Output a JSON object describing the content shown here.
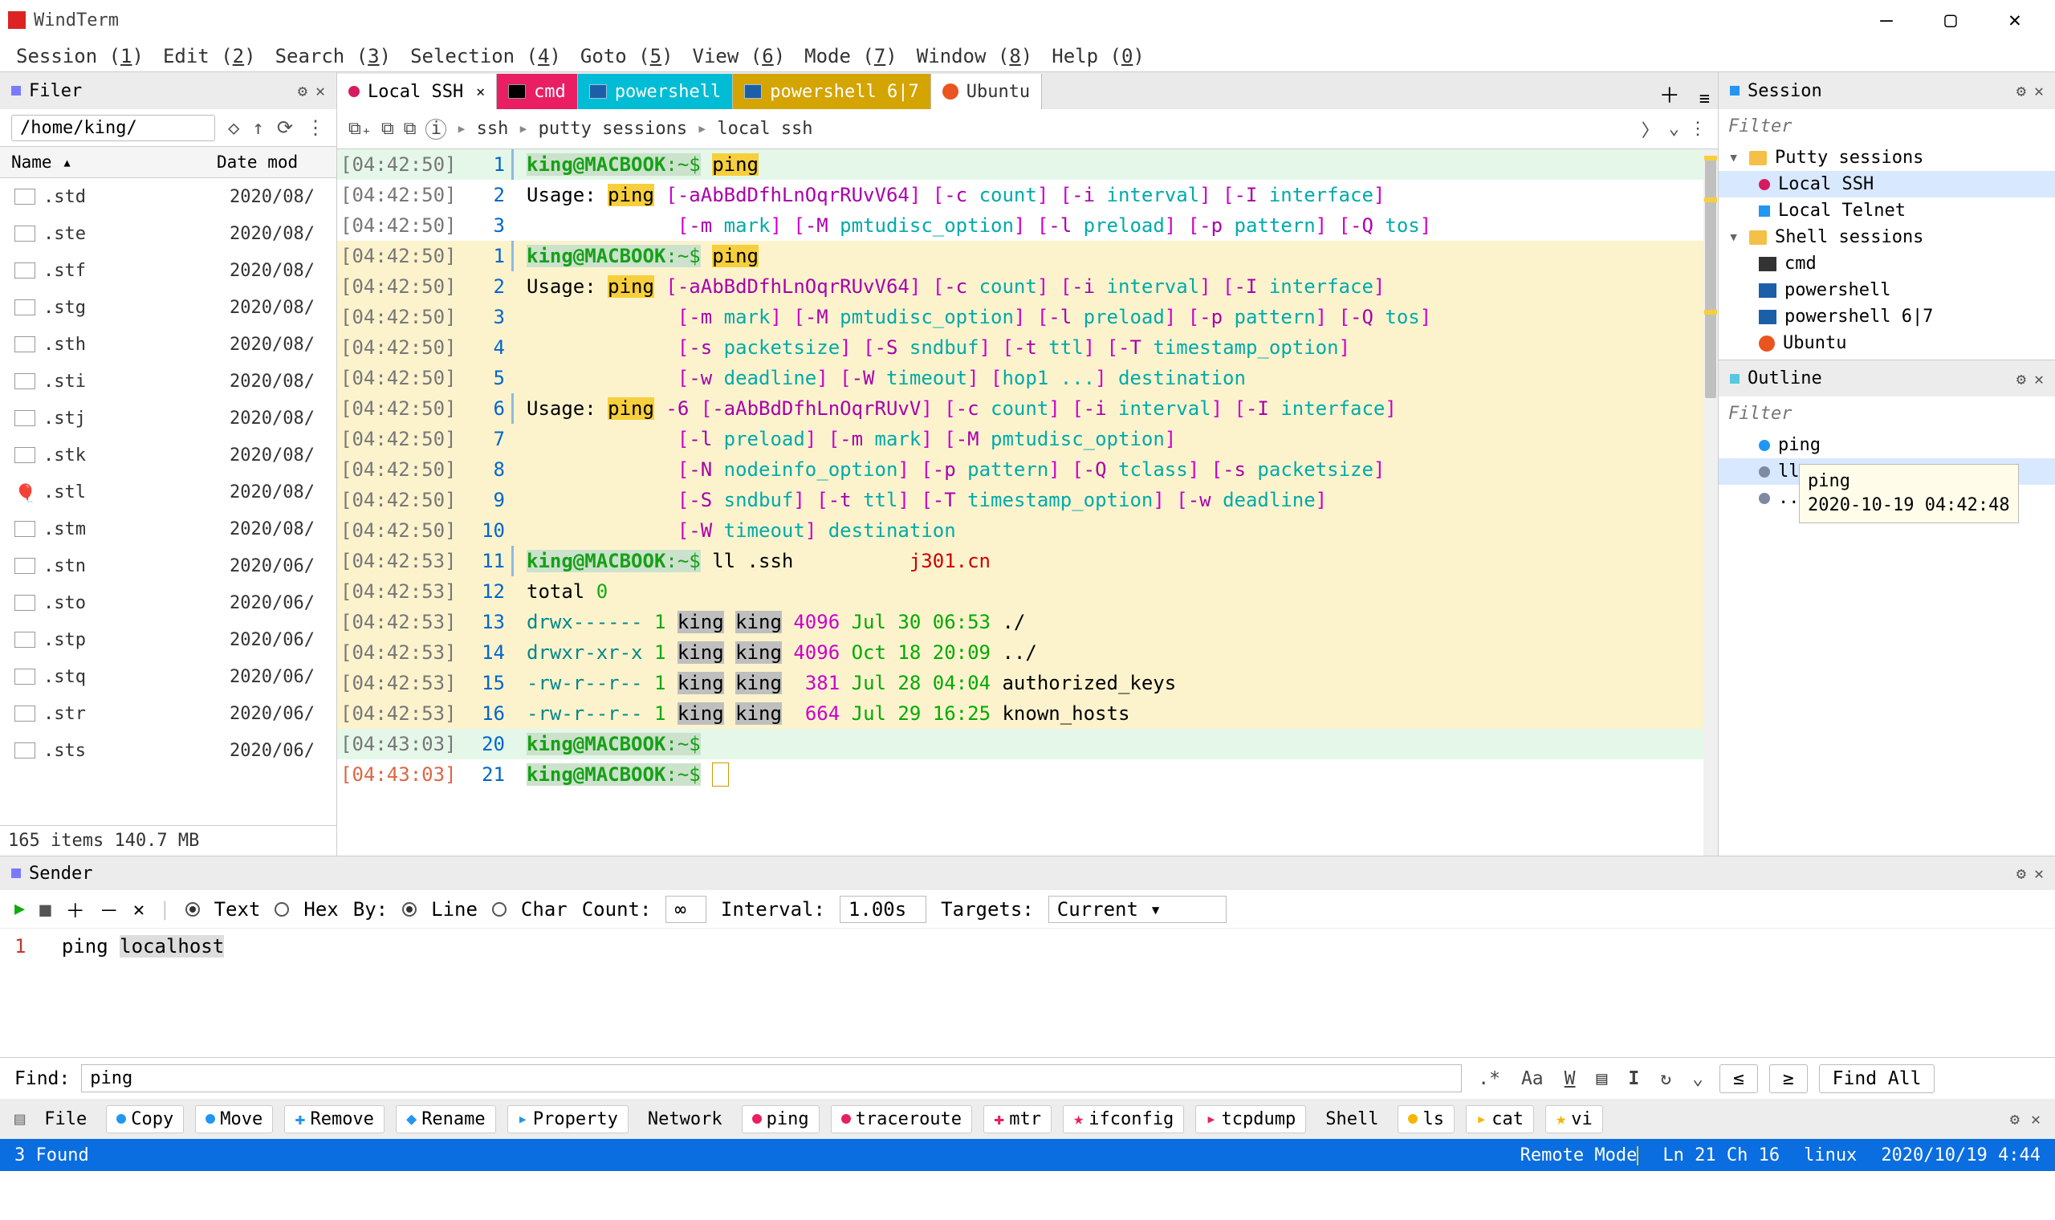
{
  "app": {
    "title": "WindTerm"
  },
  "menu": [
    "Session (1)",
    "Edit (2)",
    "Search (3)",
    "Selection (4)",
    "Goto (5)",
    "View (6)",
    "Mode (7)",
    "Window (8)",
    "Help (0)"
  ],
  "filer": {
    "panel_title": "Filer",
    "path": "/home/king/",
    "columns": [
      "Name",
      "Date mod"
    ],
    "rows": [
      {
        "name": ".std",
        "date": "2020/08/",
        "icon": "file"
      },
      {
        "name": ".ste",
        "date": "2020/08/",
        "icon": "file"
      },
      {
        "name": ".stf",
        "date": "2020/08/",
        "icon": "file"
      },
      {
        "name": ".stg",
        "date": "2020/08/",
        "icon": "file"
      },
      {
        "name": ".sth",
        "date": "2020/08/",
        "icon": "file"
      },
      {
        "name": ".sti",
        "date": "2020/08/",
        "icon": "file"
      },
      {
        "name": ".stj",
        "date": "2020/08/",
        "icon": "file"
      },
      {
        "name": ".stk",
        "date": "2020/08/",
        "icon": "file"
      },
      {
        "name": ".stl",
        "date": "2020/08/",
        "icon": "balloon"
      },
      {
        "name": ".stm",
        "date": "2020/08/",
        "icon": "file"
      },
      {
        "name": ".stn",
        "date": "2020/06/",
        "icon": "file"
      },
      {
        "name": ".sto",
        "date": "2020/06/",
        "icon": "file"
      },
      {
        "name": ".stp",
        "date": "2020/06/",
        "icon": "file"
      },
      {
        "name": ".stq",
        "date": "2020/06/",
        "icon": "file"
      },
      {
        "name": ".str",
        "date": "2020/06/",
        "icon": "file"
      },
      {
        "name": ".sts",
        "date": "2020/06/",
        "icon": "file"
      }
    ],
    "status": "165 items 140.7 MB"
  },
  "tabs": [
    {
      "label": "Local SSH",
      "bg": "#ffffff",
      "dot": "#d81b60"
    },
    {
      "label": "cmd",
      "bg": "#e91e63",
      "fg": "#fff",
      "icon": "#000"
    },
    {
      "label": "powershell",
      "bg": "#00bcd4",
      "fg": "#fff",
      "icon": "#1b5fa8"
    },
    {
      "label": "powershell 6|7",
      "bg": "#d4a400",
      "fg": "#fff",
      "icon": "#1b5fa8"
    },
    {
      "label": "Ubuntu",
      "bg": "#ffffff",
      "icon": "#e95420",
      "fg": "#333"
    }
  ],
  "breadcrumb": [
    "ssh",
    "putty sessions",
    "local ssh"
  ],
  "terminal": {
    "watermark": "j301.cn",
    "lines": [
      {
        "ts": "[04:42:50]",
        "n": "1",
        "bg": "top",
        "fold": 1,
        "html": "<span class='prompt'><span class='u'>king</span><span class='h'>@MACBOOK</span><span class='p'>:~$</span></span> <span class='hi'>ping</span>"
      },
      {
        "ts": "[04:42:50]",
        "n": "2",
        "bg": "use",
        "html": "Usage: <span class='hi'>ping</span> <span class='mag'>[</span><span class='dmag'>-aAbBdDfhLnOqrRUvV64</span><span class='mag'>]</span> <span class='mag'>[</span><span class='dmag'>-c</span> <span class='cyan'>count</span><span class='mag'>]</span> <span class='mag'>[</span><span class='dmag'>-i</span> <span class='cyan'>interval</span><span class='mag'>]</span> <span class='mag'>[</span><span class='dmag'>-I</span> <span class='cyan'>interface</span><span class='mag'>]</span>"
      },
      {
        "ts": "[04:42:50]",
        "n": "3",
        "bg": "use",
        "html": "             <span class='mag'>[</span><span class='dmag'>-m</span> <span class='cyan'>mark</span><span class='mag'>]</span> <span class='mag'>[</span><span class='dmag'>-M</span> <span class='cyan'>pmtudisc_option</span><span class='mag'>]</span> <span class='mag'>[</span><span class='dmag'>-l</span> <span class='cyan'>preload</span><span class='mag'>]</span> <span class='mag'>[</span><span class='dmag'>-p</span> <span class='cyan'>pattern</span><span class='mag'>]</span> <span class='mag'>[</span><span class='dmag'>-Q</span> <span class='cyan'>tos</span><span class='mag'>]</span>"
      },
      {
        "ts": "[04:42:50]",
        "n": "1",
        "bg": "yel",
        "fold": 1,
        "html": "<span class='prompt'><span class='u'>king</span><span class='h'>@MACBOOK</span><span class='p'>:~$</span></span> <span class='hi'>ping</span>"
      },
      {
        "ts": "[04:42:50]",
        "n": "2",
        "bg": "yel",
        "html": "Usage: <span class='hi'>ping</span> <span class='mag'>[</span><span class='dmag'>-aAbBdDfhLnOqrRUvV64</span><span class='mag'>]</span> <span class='mag'>[</span><span class='dmag'>-c</span> <span class='cyan'>count</span><span class='mag'>]</span> <span class='mag'>[</span><span class='dmag'>-i</span> <span class='cyan'>interval</span><span class='mag'>]</span> <span class='mag'>[</span><span class='dmag'>-I</span> <span class='cyan'>interface</span><span class='mag'>]</span>"
      },
      {
        "ts": "[04:42:50]",
        "n": "3",
        "bg": "yel",
        "html": "             <span class='mag'>[</span><span class='dmag'>-m</span> <span class='cyan'>mark</span><span class='mag'>]</span> <span class='mag'>[</span><span class='dmag'>-M</span> <span class='cyan'>pmtudisc_option</span><span class='mag'>]</span> <span class='mag'>[</span><span class='dmag'>-l</span> <span class='cyan'>preload</span><span class='mag'>]</span> <span class='mag'>[</span><span class='dmag'>-p</span> <span class='cyan'>pattern</span><span class='mag'>]</span> <span class='mag'>[</span><span class='dmag'>-Q</span> <span class='cyan'>tos</span><span class='mag'>]</span>"
      },
      {
        "ts": "[04:42:50]",
        "n": "4",
        "bg": "yel",
        "html": "             <span class='mag'>[</span><span class='dmag'>-s</span> <span class='cyan'>packetsize</span><span class='mag'>]</span> <span class='mag'>[</span><span class='dmag'>-S</span> <span class='cyan'>sndbuf</span><span class='mag'>]</span> <span class='mag'>[</span><span class='dmag'>-t</span> <span class='cyan'>ttl</span><span class='mag'>]</span> <span class='mag'>[</span><span class='dmag'>-T</span> <span class='cyan'>timestamp_option</span><span class='mag'>]</span>"
      },
      {
        "ts": "[04:42:50]",
        "n": "5",
        "bg": "yel",
        "html": "             <span class='mag'>[</span><span class='dmag'>-w</span> <span class='cyan'>deadline</span><span class='mag'>]</span> <span class='mag'>[</span><span class='dmag'>-W</span> <span class='cyan'>timeout</span><span class='mag'>]</span> <span class='mag'>[</span><span class='cyan'>hop1 ...</span><span class='mag'>]</span> <span class='cyan'>destination</span>"
      },
      {
        "ts": "[04:42:50]",
        "n": "6",
        "bg": "yel",
        "fold": 1,
        "html": "Usage: <span class='hi'>ping</span> <span class='dmag'>-6</span> <span class='mag'>[</span><span class='dmag'>-aAbBdDfhLnOqrRUvV</span><span class='mag'>]</span> <span class='mag'>[</span><span class='dmag'>-c</span> <span class='cyan'>count</span><span class='mag'>]</span> <span class='mag'>[</span><span class='dmag'>-i</span> <span class='cyan'>interval</span><span class='mag'>]</span> <span class='mag'>[</span><span class='dmag'>-I</span> <span class='cyan'>interface</span><span class='mag'>]</span>"
      },
      {
        "ts": "[04:42:50]",
        "n": "7",
        "bg": "yel",
        "html": "             <span class='mag'>[</span><span class='dmag'>-l</span> <span class='cyan'>preload</span><span class='mag'>]</span> <span class='mag'>[</span><span class='dmag'>-m</span> <span class='cyan'>mark</span><span class='mag'>]</span> <span class='mag'>[</span><span class='dmag'>-M</span> <span class='cyan'>pmtudisc_option</span><span class='mag'>]</span>"
      },
      {
        "ts": "[04:42:50]",
        "n": "8",
        "bg": "yel",
        "html": "             <span class='mag'>[</span><span class='dmag'>-N</span> <span class='cyan'>nodeinfo_option</span><span class='mag'>]</span> <span class='mag'>[</span><span class='dmag'>-p</span> <span class='cyan'>pattern</span><span class='mag'>]</span> <span class='mag'>[</span><span class='dmag'>-Q</span> <span class='cyan'>tclass</span><span class='mag'>]</span> <span class='mag'>[</span><span class='dmag'>-s</span> <span class='cyan'>packetsize</span><span class='mag'>]</span>"
      },
      {
        "ts": "[04:42:50]",
        "n": "9",
        "bg": "yel",
        "html": "             <span class='mag'>[</span><span class='dmag'>-S</span> <span class='cyan'>sndbuf</span><span class='mag'>]</span> <span class='mag'>[</span><span class='dmag'>-t</span> <span class='cyan'>ttl</span><span class='mag'>]</span> <span class='mag'>[</span><span class='dmag'>-T</span> <span class='cyan'>timestamp_option</span><span class='mag'>]</span> <span class='mag'>[</span><span class='dmag'>-w</span> <span class='cyan'>deadline</span><span class='mag'>]</span>"
      },
      {
        "ts": "[04:42:50]",
        "n": "10",
        "bg": "yel",
        "html": "             <span class='mag'>[</span><span class='dmag'>-W</span> <span class='cyan'>timeout</span><span class='mag'>]</span> <span class='cyan'>destination</span>"
      },
      {
        "ts": "[04:42:53]",
        "n": "11",
        "bg": "yel",
        "fold": 1,
        "html": "<span class='prompt'><span class='u'>king</span><span class='h'>@MACBOOK</span><span class='p'>:~$</span></span> ll .ssh          <span class='red'>j301.cn</span>"
      },
      {
        "ts": "[04:42:53]",
        "n": "12",
        "bg": "yel",
        "html": "total <span class='green'>0</span>"
      },
      {
        "ts": "[04:42:53]",
        "n": "13",
        "bg": "yel",
        "html": "<span class='dcyan'>drwx------</span> <span class='green'>1</span> <span class='tsel'>king</span> <span class='tsel'>king</span> <span class='mag'>4096</span> <span class='dgreen'>Jul 30 06:53</span> ./"
      },
      {
        "ts": "[04:42:53]",
        "n": "14",
        "bg": "yel",
        "html": "<span class='dcyan'>drwxr-xr-x</span> <span class='green'>1</span> <span class='tsel'>king</span> <span class='tsel'>king</span> <span class='mag'>4096</span> <span class='dgreen'>Oct 18 20:09</span> ../"
      },
      {
        "ts": "[04:42:53]",
        "n": "15",
        "bg": "yel",
        "html": "<span class='dcyan'>-rw-r--r--</span> <span class='green'>1</span> <span class='tsel'>king</span> <span class='tsel'>king</span>  <span class='mag'>381</span> <span class='dgreen'>Jul 28 04:04</span> authorized_keys"
      },
      {
        "ts": "[04:42:53]",
        "n": "16",
        "bg": "yel",
        "html": "<span class='dcyan'>-rw-r--r--</span> <span class='green'>1</span> <span class='tsel'>king</span> <span class='tsel'>king</span>  <span class='mag'>664</span> <span class='dgreen'>Jul 29 16:25</span> known_hosts"
      },
      {
        "ts": "[04:43:03]",
        "n": "20",
        "bg": "cur",
        "html": "<span class='prompt'><span class='u'>king</span><span class='h'>@MACBOOK</span><span class='p'>:~$</span></span>"
      },
      {
        "ts": "[04:43:03]",
        "tsc": "now",
        "n": "21",
        "bg": "use",
        "html": "<span class='prompt'><span class='u'>king</span><span class='h'>@MACBOOK</span><span class='p'>:~$</span></span> <span style='border:1px solid #c90;padding:0 2px;'>&nbsp;</span>"
      }
    ]
  },
  "session": {
    "panel_title": "Session",
    "filter_placeholder": "Filter",
    "tree": [
      {
        "lvl": 1,
        "type": "folder",
        "twist": "▾",
        "label": "Putty sessions"
      },
      {
        "lvl": 2,
        "type": "dot",
        "color": "#d81b60",
        "label": "Local SSH",
        "sel": true
      },
      {
        "lvl": 2,
        "type": "sq",
        "color": "#2196f3",
        "label": "Local Telnet"
      },
      {
        "lvl": 1,
        "type": "folder",
        "twist": "▾",
        "label": "Shell sessions"
      },
      {
        "lvl": 2,
        "type": "icon",
        "color": "#333",
        "label": "cmd"
      },
      {
        "lvl": 2,
        "type": "icon",
        "color": "#1b5fa8",
        "label": "powershell"
      },
      {
        "lvl": 2,
        "type": "icon",
        "color": "#1b5fa8",
        "label": "powershell 6|7"
      },
      {
        "lvl": 2,
        "type": "circ",
        "color": "#e95420",
        "label": "Ubuntu"
      }
    ]
  },
  "outline": {
    "panel_title": "Outline",
    "filter_placeholder": "Filter",
    "items": [
      {
        "label": "ping",
        "color": "#2196f3"
      },
      {
        "label": "ll",
        "color": "#7e8aa0",
        "sel": true
      },
      {
        "label": "..",
        "color": "#7e8aa0"
      }
    ],
    "tooltip": {
      "line1": "ping",
      "line2": "2020-10-19 04:42:48"
    }
  },
  "sender": {
    "panel_title": "Sender",
    "toolbar": {
      "text": "Text",
      "hex": "Hex",
      "by": "By:",
      "line": "Line",
      "char": "Char",
      "count": "Count:",
      "count_val": "∞",
      "interval": "Interval:",
      "interval_val": "1.00s",
      "targets": "Targets:",
      "target_val": "Current"
    },
    "ln": "1",
    "command": "ping ",
    "arg": "localhost"
  },
  "find": {
    "label": "Find:",
    "value": "ping",
    "findall": "Find All"
  },
  "tools": {
    "file": "File",
    "items": [
      {
        "label": "Copy",
        "color": "#2196f3"
      },
      {
        "label": "Move",
        "color": "#2196f3"
      },
      {
        "label": "Remove",
        "color": "#2196f3",
        "glyph": "✚"
      },
      {
        "label": "Rename",
        "color": "#2196f3",
        "glyph": "◆"
      },
      {
        "label": "Property",
        "color": "#2196f3",
        "glyph": "▸"
      }
    ],
    "network": "Network",
    "nitems": [
      {
        "label": "ping",
        "color": "#e91e63"
      },
      {
        "label": "traceroute",
        "color": "#e91e63"
      },
      {
        "label": "mtr",
        "color": "#e91e63",
        "glyph": "✚"
      },
      {
        "label": "ifconfig",
        "color": "#e91e63",
        "glyph": "★"
      },
      {
        "label": "tcpdump",
        "color": "#e91e63",
        "glyph": "▸"
      }
    ],
    "shell": "Shell",
    "sitems": [
      {
        "label": "ls",
        "color": "#f7b500"
      },
      {
        "label": "cat",
        "color": "#f7b500",
        "glyph": "▸"
      },
      {
        "label": "vi",
        "color": "#f7b500",
        "glyph": "★"
      }
    ]
  },
  "status": {
    "found": "3 Found",
    "mode": "Remote Mode",
    "pos": "Ln 21 Ch 16",
    "os": "linux",
    "time": "2020/10/19 4:44"
  }
}
